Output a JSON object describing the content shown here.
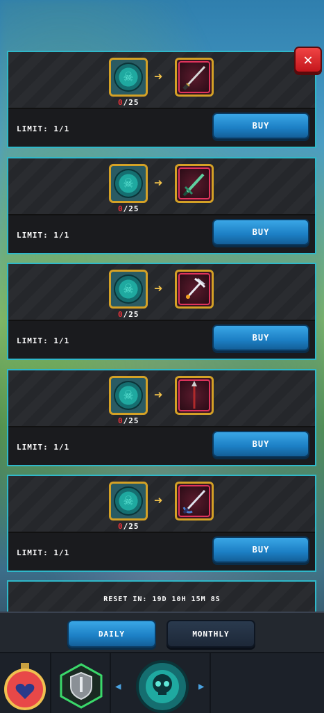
{
  "shop": {
    "close_label": "✕",
    "offers": [
      {
        "count_have": "0",
        "count_sep_total": "/25",
        "limit": "LIMIT: 1/1",
        "buy": "BUY",
        "item_icon": "dark-katana-icon"
      },
      {
        "count_have": "0",
        "count_sep_total": "/25",
        "limit": "LIMIT: 1/1",
        "buy": "BUY",
        "item_icon": "green-sword-icon"
      },
      {
        "count_have": "0",
        "count_sep_total": "/25",
        "limit": "LIMIT: 1/1",
        "buy": "BUY",
        "item_icon": "silver-trident-icon"
      },
      {
        "count_have": "0",
        "count_sep_total": "/25",
        "limit": "LIMIT: 1/1",
        "buy": "BUY",
        "item_icon": "crimson-spear-icon"
      },
      {
        "count_have": "0",
        "count_sep_total": "/25",
        "limit": "LIMIT: 1/1",
        "buy": "BUY",
        "item_icon": "rapier-icon"
      }
    ],
    "reset_text": "RESET IN: 19D 10H 15M 8S"
  },
  "tabs": {
    "daily": "DAILY",
    "monthly": "MONTHLY"
  },
  "colors": {
    "accent_cyan": "#2fb8c9",
    "buy_blue": "#1c7fc4",
    "close_red": "#c4161c",
    "count_red": "#e8333b",
    "frame_gold": "#d4a126"
  }
}
